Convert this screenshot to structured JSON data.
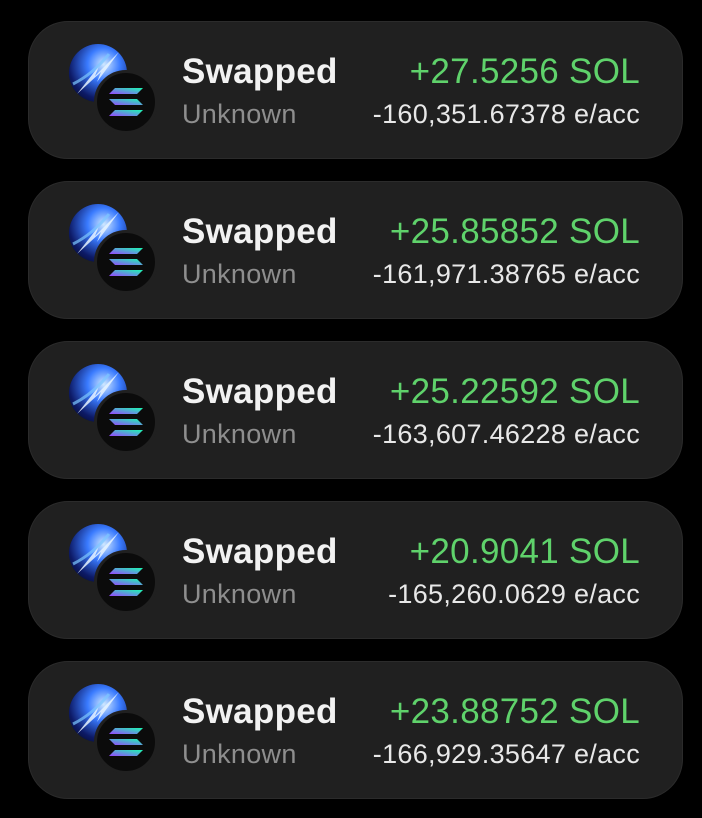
{
  "colors": {
    "background": "#000000",
    "card": "#202020",
    "amount_positive": "#5fd26b",
    "subtitle": "#8e8e8e"
  },
  "transactions": [
    {
      "title": "Swapped",
      "subtitle": "Unknown",
      "amount": "+27.5256 SOL",
      "value": "-160,351.67378 e/acc",
      "token_icon": "blue-lightning-token-icon",
      "chain_icon": "solana-icon"
    },
    {
      "title": "Swapped",
      "subtitle": "Unknown",
      "amount": "+25.85852 SOL",
      "value": "-161,971.38765 e/acc",
      "token_icon": "blue-lightning-token-icon",
      "chain_icon": "solana-icon"
    },
    {
      "title": "Swapped",
      "subtitle": "Unknown",
      "amount": "+25.22592 SOL",
      "value": "-163,607.46228 e/acc",
      "token_icon": "blue-lightning-token-icon",
      "chain_icon": "solana-icon"
    },
    {
      "title": "Swapped",
      "subtitle": "Unknown",
      "amount": "+20.9041 SOL",
      "value": "-165,260.0629 e/acc",
      "token_icon": "blue-lightning-token-icon",
      "chain_icon": "solana-icon"
    },
    {
      "title": "Swapped",
      "subtitle": "Unknown",
      "amount": "+23.88752 SOL",
      "value": "-166,929.35647 e/acc",
      "token_icon": "blue-lightning-token-icon",
      "chain_icon": "solana-icon"
    }
  ]
}
